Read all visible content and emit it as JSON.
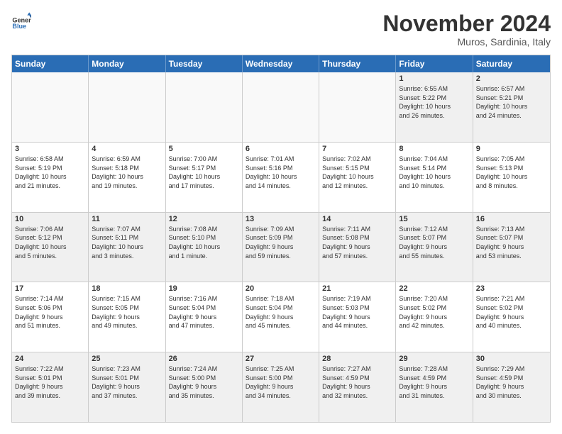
{
  "logo": {
    "general": "General",
    "blue": "Blue"
  },
  "header": {
    "title": "November 2024",
    "location": "Muros, Sardinia, Italy"
  },
  "weekdays": [
    "Sunday",
    "Monday",
    "Tuesday",
    "Wednesday",
    "Thursday",
    "Friday",
    "Saturday"
  ],
  "rows": [
    [
      {
        "day": "",
        "info": "",
        "empty": true
      },
      {
        "day": "",
        "info": "",
        "empty": true
      },
      {
        "day": "",
        "info": "",
        "empty": true
      },
      {
        "day": "",
        "info": "",
        "empty": true
      },
      {
        "day": "",
        "info": "",
        "empty": true
      },
      {
        "day": "1",
        "info": "Sunrise: 6:55 AM\nSunset: 5:22 PM\nDaylight: 10 hours\nand 26 minutes."
      },
      {
        "day": "2",
        "info": "Sunrise: 6:57 AM\nSunset: 5:21 PM\nDaylight: 10 hours\nand 24 minutes."
      }
    ],
    [
      {
        "day": "3",
        "info": "Sunrise: 6:58 AM\nSunset: 5:19 PM\nDaylight: 10 hours\nand 21 minutes."
      },
      {
        "day": "4",
        "info": "Sunrise: 6:59 AM\nSunset: 5:18 PM\nDaylight: 10 hours\nand 19 minutes."
      },
      {
        "day": "5",
        "info": "Sunrise: 7:00 AM\nSunset: 5:17 PM\nDaylight: 10 hours\nand 17 minutes."
      },
      {
        "day": "6",
        "info": "Sunrise: 7:01 AM\nSunset: 5:16 PM\nDaylight: 10 hours\nand 14 minutes."
      },
      {
        "day": "7",
        "info": "Sunrise: 7:02 AM\nSunset: 5:15 PM\nDaylight: 10 hours\nand 12 minutes."
      },
      {
        "day": "8",
        "info": "Sunrise: 7:04 AM\nSunset: 5:14 PM\nDaylight: 10 hours\nand 10 minutes."
      },
      {
        "day": "9",
        "info": "Sunrise: 7:05 AM\nSunset: 5:13 PM\nDaylight: 10 hours\nand 8 minutes."
      }
    ],
    [
      {
        "day": "10",
        "info": "Sunrise: 7:06 AM\nSunset: 5:12 PM\nDaylight: 10 hours\nand 5 minutes."
      },
      {
        "day": "11",
        "info": "Sunrise: 7:07 AM\nSunset: 5:11 PM\nDaylight: 10 hours\nand 3 minutes."
      },
      {
        "day": "12",
        "info": "Sunrise: 7:08 AM\nSunset: 5:10 PM\nDaylight: 10 hours\nand 1 minute."
      },
      {
        "day": "13",
        "info": "Sunrise: 7:09 AM\nSunset: 5:09 PM\nDaylight: 9 hours\nand 59 minutes."
      },
      {
        "day": "14",
        "info": "Sunrise: 7:11 AM\nSunset: 5:08 PM\nDaylight: 9 hours\nand 57 minutes."
      },
      {
        "day": "15",
        "info": "Sunrise: 7:12 AM\nSunset: 5:07 PM\nDaylight: 9 hours\nand 55 minutes."
      },
      {
        "day": "16",
        "info": "Sunrise: 7:13 AM\nSunset: 5:07 PM\nDaylight: 9 hours\nand 53 minutes."
      }
    ],
    [
      {
        "day": "17",
        "info": "Sunrise: 7:14 AM\nSunset: 5:06 PM\nDaylight: 9 hours\nand 51 minutes."
      },
      {
        "day": "18",
        "info": "Sunrise: 7:15 AM\nSunset: 5:05 PM\nDaylight: 9 hours\nand 49 minutes."
      },
      {
        "day": "19",
        "info": "Sunrise: 7:16 AM\nSunset: 5:04 PM\nDaylight: 9 hours\nand 47 minutes."
      },
      {
        "day": "20",
        "info": "Sunrise: 7:18 AM\nSunset: 5:04 PM\nDaylight: 9 hours\nand 45 minutes."
      },
      {
        "day": "21",
        "info": "Sunrise: 7:19 AM\nSunset: 5:03 PM\nDaylight: 9 hours\nand 44 minutes."
      },
      {
        "day": "22",
        "info": "Sunrise: 7:20 AM\nSunset: 5:02 PM\nDaylight: 9 hours\nand 42 minutes."
      },
      {
        "day": "23",
        "info": "Sunrise: 7:21 AM\nSunset: 5:02 PM\nDaylight: 9 hours\nand 40 minutes."
      }
    ],
    [
      {
        "day": "24",
        "info": "Sunrise: 7:22 AM\nSunset: 5:01 PM\nDaylight: 9 hours\nand 39 minutes."
      },
      {
        "day": "25",
        "info": "Sunrise: 7:23 AM\nSunset: 5:01 PM\nDaylight: 9 hours\nand 37 minutes."
      },
      {
        "day": "26",
        "info": "Sunrise: 7:24 AM\nSunset: 5:00 PM\nDaylight: 9 hours\nand 35 minutes."
      },
      {
        "day": "27",
        "info": "Sunrise: 7:25 AM\nSunset: 5:00 PM\nDaylight: 9 hours\nand 34 minutes."
      },
      {
        "day": "28",
        "info": "Sunrise: 7:27 AM\nSunset: 4:59 PM\nDaylight: 9 hours\nand 32 minutes."
      },
      {
        "day": "29",
        "info": "Sunrise: 7:28 AM\nSunset: 4:59 PM\nDaylight: 9 hours\nand 31 minutes."
      },
      {
        "day": "30",
        "info": "Sunrise: 7:29 AM\nSunset: 4:59 PM\nDaylight: 9 hours\nand 30 minutes."
      }
    ]
  ]
}
